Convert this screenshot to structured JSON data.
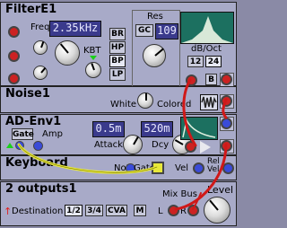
{
  "filter": {
    "title": "FilterE1",
    "freq_label": "Freq",
    "freq_value": "2.35kHz",
    "kbt_label": "KBT",
    "modes": [
      "BR",
      "HP",
      "BP",
      "LP"
    ],
    "active_mode": "BP",
    "res_label": "Res",
    "gc_label": "GC",
    "res_value": "109",
    "slope_label": "dB/Oct",
    "slopes": [
      "12",
      "24"
    ],
    "active_slope": "24",
    "out_button": "B"
  },
  "noise": {
    "title": "Noise1",
    "white_label": "White",
    "colored_label": "Colored"
  },
  "adenv": {
    "title": "AD-Env1",
    "gate_label": "Gate",
    "amp_label": "Amp",
    "attack_label": "Attack",
    "attack_value": "0.5m",
    "decay_label": "Dcy",
    "decay_value": "520m"
  },
  "keyboard": {
    "title": "Keyboard",
    "note_label": "Note",
    "gate_label": "Gate",
    "vel_label": "Vel",
    "rel_label": "Rel Vel"
  },
  "outputs": {
    "title": "2 outputs1",
    "destination_label": "Destination",
    "destinations": [
      "1/2",
      "3/4",
      "CVA"
    ],
    "active_destination": "1/2",
    "mute_label": "M",
    "mixbus_label": "Mix Bus",
    "left_label": "L",
    "right_label": "R",
    "level_label": "Level"
  },
  "colors": {
    "panel": "#a8aac8",
    "display": "#3a3a8c",
    "scope": "#1c7060",
    "jack_red": "#cc2222",
    "jack_blue": "#3a4bd8",
    "cable_yellow": "#e8e83a",
    "cable_red": "#d01818"
  }
}
